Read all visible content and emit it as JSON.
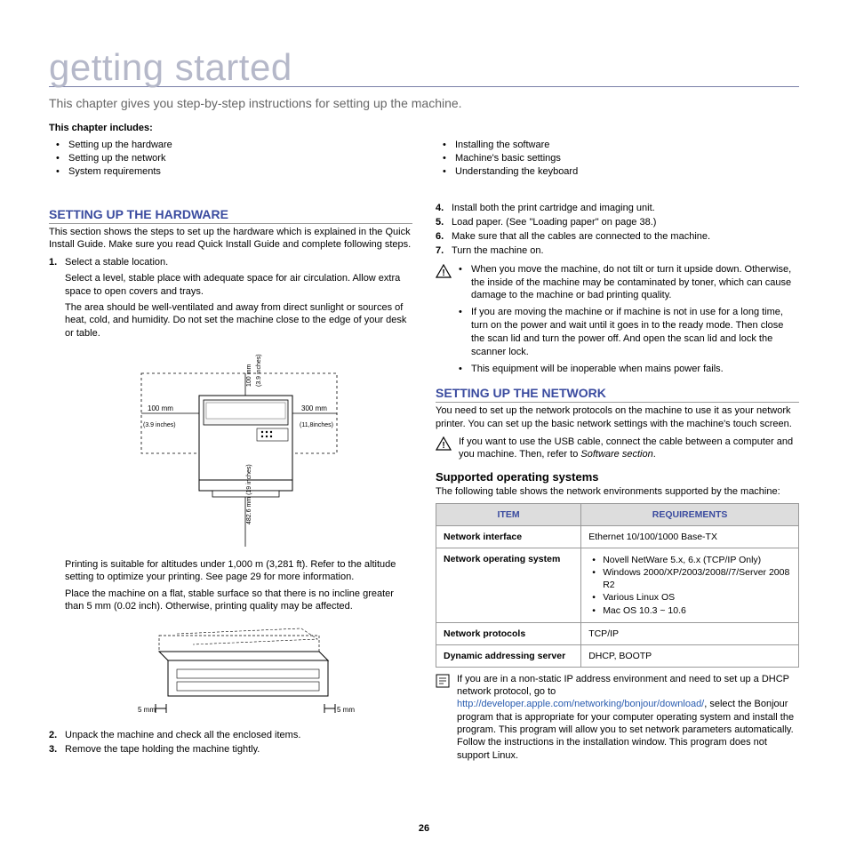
{
  "title": "getting started",
  "intro": "This chapter gives you step-by-step instructions for setting up the machine.",
  "chapter_heading": "This chapter includes:",
  "toc_left": [
    "Setting up the hardware",
    "Setting up the network",
    "System requirements"
  ],
  "toc_right": [
    "Installing the software",
    "Machine's basic settings",
    "Understanding the keyboard"
  ],
  "hardware": {
    "heading": "Setting up the hardware",
    "intro": "This section shows the steps to set up the hardware which is explained in the Quick Install Guide. Make sure you read Quick Install Guide and complete following steps.",
    "step1_num": "1.",
    "step1": "Select a stable location.",
    "step1_p1": "Select a level, stable place with adequate space for air circulation. Allow extra space to open covers and trays.",
    "step1_p2": "The area should be well-ventilated and away from direct sunlight or sources of heat, cold, and humidity. Do not set the machine close to the edge of your desk or table.",
    "fig1_top": "100 mm",
    "fig1_top_in": "(3.9 inches)",
    "fig1_left": "100 mm",
    "fig1_left_in": "(3.9 inches)",
    "fig1_right": "300 mm",
    "fig1_right_in": "(11,8inches)",
    "fig1_bottom": "482.6 mm (19 inches)",
    "step1_p3": "Printing is suitable for altitudes under 1,000 m (3,281 ft). Refer to the altitude setting to optimize your printing. See page 29 for more information.",
    "step1_p4": "Place the machine on a flat, stable surface so that there is no incline greater than 5 mm (0.02 inch). Otherwise, printing quality may be affected.",
    "fig2_left": "5 mm",
    "fig2_right": "5 mm",
    "step2_num": "2.",
    "step2": "Unpack the machine and check all the enclosed items.",
    "step3_num": "3.",
    "step3": "Remove the tape holding the machine tightly."
  },
  "right_steps": {
    "step4_num": "4.",
    "step4": "Install both the print cartridge and imaging unit.",
    "step5_num": "5.",
    "step5": "Load paper. (See \"Loading paper\" on page 38.)",
    "step6_num": "6.",
    "step6": "Make sure that all the cables are connected to the machine.",
    "step7_num": "7.",
    "step7": "Turn the machine on."
  },
  "caution": {
    "items": [
      "When you move the machine, do not tilt or turn it upside down. Otherwise, the inside of the machine may be contaminated by toner, which can cause damage to the machine or bad printing quality.",
      "If you are moving the machine or if machine is not in use for a long time, turn on the power and wait until it goes in to the ready mode. Then close the scan lid and turn the power off. And open the scan lid and lock the scanner lock.",
      "This equipment will be inoperable when mains power fails."
    ]
  },
  "network": {
    "heading": "Setting up the network",
    "intro": "You need to set up the network protocols on the machine to use it as your network printer. You can set up the basic network settings with the machine's touch screen.",
    "note_pre": "If you want to use the USB cable, connect the cable between a computer and you machine. Then, refer to ",
    "note_italic": "Software section",
    "note_post": ".",
    "sub_heading": "Supported operating systems",
    "sub_intro": "The following table shows the network environments supported by the machine:",
    "table": {
      "th1": "Item",
      "th2": "Requirements",
      "rows": [
        {
          "item": "Network interface",
          "req_text": "Ethernet 10/100/1000 Base-TX"
        },
        {
          "item": "Network operating system",
          "req_list": [
            "Novell NetWare 5.x, 6.x (TCP/IP Only)",
            "Windows 2000/XP/2003/2008//7/Server 2008 R2",
            "Various Linux OS",
            "Mac OS 10.3 ~ 10.6"
          ]
        },
        {
          "item": "Network protocols",
          "req_text": "TCP/IP"
        },
        {
          "item": "Dynamic addressing server",
          "req_text": "DHCP, BOOTP"
        }
      ]
    },
    "tip_pre": "If you are in a non-static IP address environment and need to set up a DHCP network protocol, go to ",
    "tip_link": "http://developer.apple.com/networking/bonjour/download/",
    "tip_post": ", select the Bonjour program that is appropriate for your computer operating system and install the program. This program will allow you to set network parameters automatically. Follow the instructions in the installation window. This program does not support Linux."
  },
  "page_num": "26"
}
